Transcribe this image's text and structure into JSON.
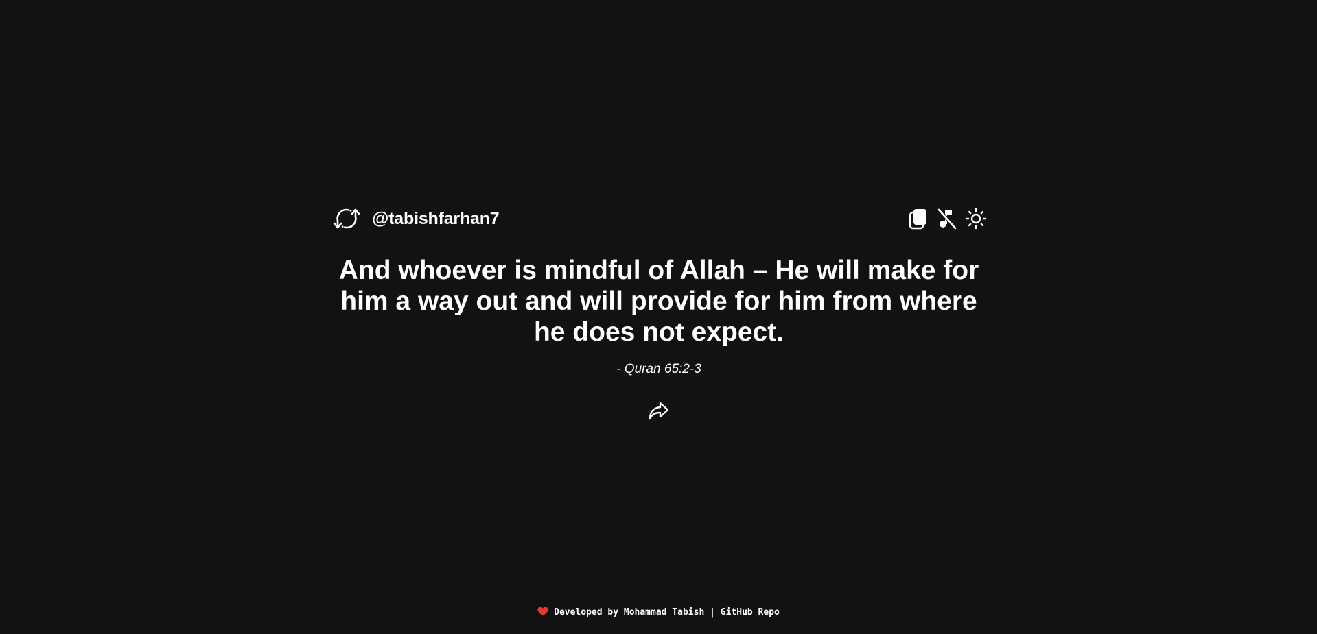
{
  "header": {
    "refresh_icon": "refresh-cycle-icon",
    "username": "@tabishfarhan7",
    "actions": [
      {
        "name": "copy-icon"
      },
      {
        "name": "music-off-icon"
      },
      {
        "name": "sun-icon"
      }
    ]
  },
  "quote": {
    "text": "And whoever is mindful of Allah – He will make for him a way out and will provide for him from where he does not expect.",
    "source": "- Quran 65:2-3",
    "share_icon": "share-icon"
  },
  "footer": {
    "heart_icon": "heart-icon",
    "developed_by": "Developed by Mohammad Tabish",
    "separator": "|",
    "repo_link": "GitHub Repo"
  },
  "colors": {
    "background": "#121212",
    "text": "#ffffff",
    "heart": "#e53935"
  }
}
